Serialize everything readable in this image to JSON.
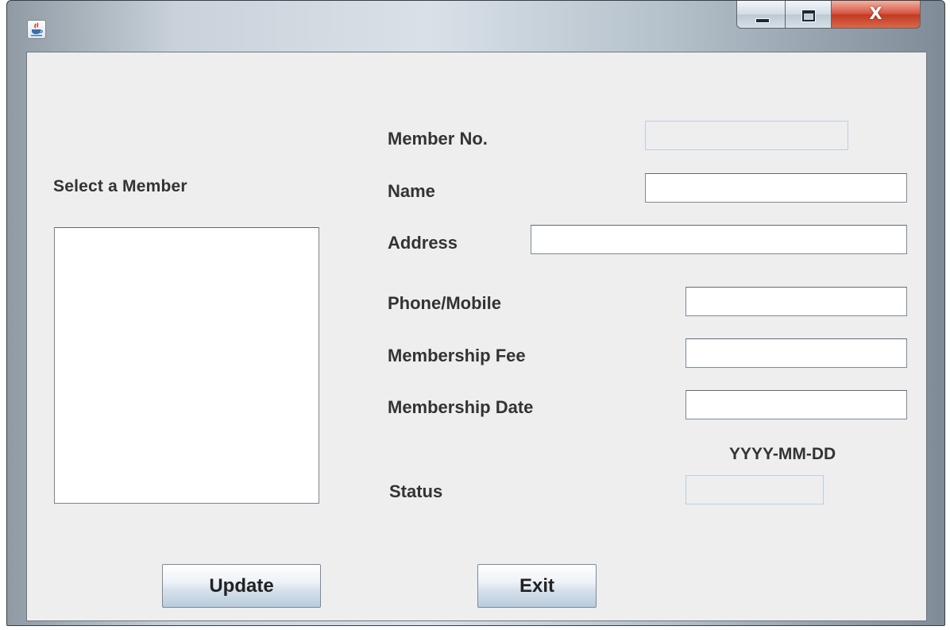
{
  "window": {
    "title": "",
    "icon": "java-cup-icon",
    "controls": {
      "minimize_glyph": "—",
      "close_glyph": "X"
    }
  },
  "member_list": {
    "label": "Select a Member",
    "items": []
  },
  "form": {
    "member_no": {
      "label": "Member No.",
      "value": ""
    },
    "name": {
      "label": "Name",
      "value": ""
    },
    "address": {
      "label": "Address",
      "value": ""
    },
    "phone": {
      "label": "Phone/Mobile",
      "value": ""
    },
    "fee": {
      "label": "Membership Fee",
      "value": ""
    },
    "date": {
      "label": "Membership Date",
      "value": "",
      "hint": "YYYY-MM-DD"
    },
    "status": {
      "label": "Status",
      "value": ""
    }
  },
  "buttons": {
    "update": "Update",
    "exit": "Exit"
  }
}
